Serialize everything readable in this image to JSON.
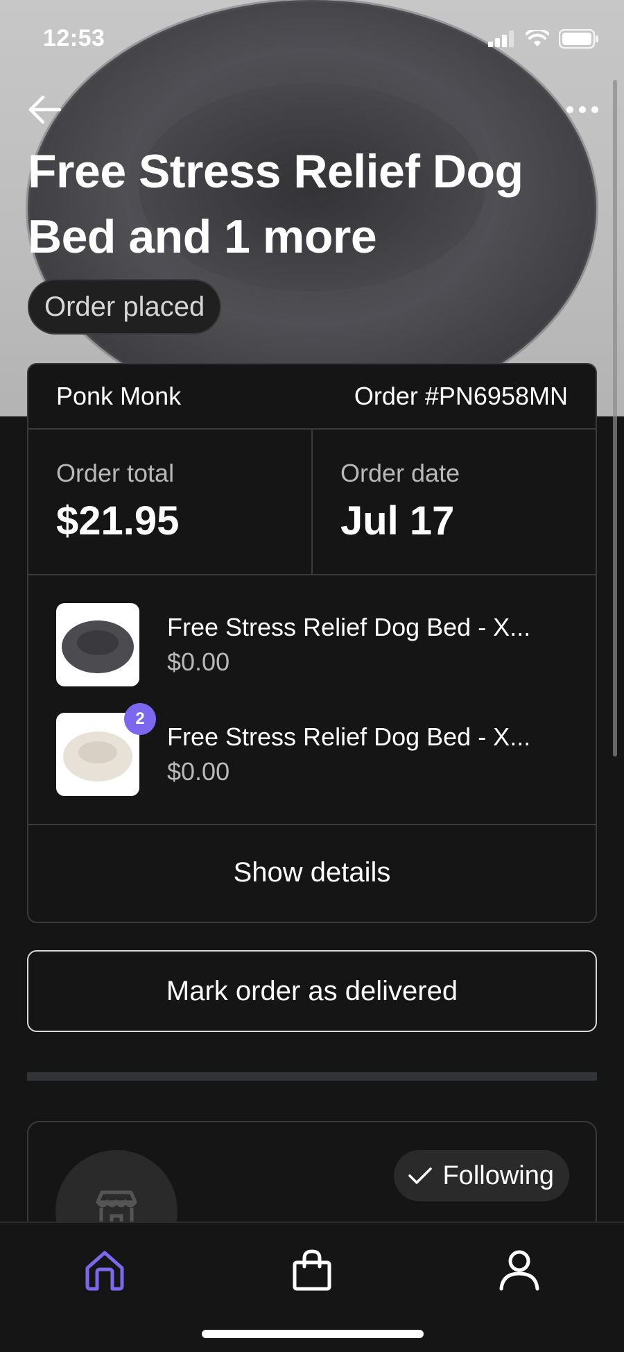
{
  "status_bar": {
    "time": "12:53"
  },
  "header": {
    "title_line1": "Free Stress Relief Dog",
    "title_line2": "Bed and 1 more",
    "status": "Order placed"
  },
  "order": {
    "shop_name": "Ponk Monk",
    "order_number": "Order #PN6958MN",
    "total_label": "Order total",
    "total_value": "$21.95",
    "date_label": "Order date",
    "date_value": "Jul 17",
    "items": [
      {
        "name": "Free Stress Relief Dog Bed - X...",
        "price": "$0.00",
        "thumb": "grey-dog-bed"
      },
      {
        "name": "Free Stress Relief Dog Bed - X...",
        "price": "$0.00",
        "thumb": "white-dog-bed",
        "quantity": "2"
      }
    ],
    "show_details_label": "Show details"
  },
  "actions": {
    "mark_delivered_label": "Mark order as delivered"
  },
  "shop": {
    "follow_label": "Following"
  },
  "tabs": [
    "home-icon",
    "bag-icon",
    "profile-icon"
  ],
  "colors": {
    "accent": "#7b68ee",
    "background": "#151515",
    "border": "#3a3a3a"
  }
}
